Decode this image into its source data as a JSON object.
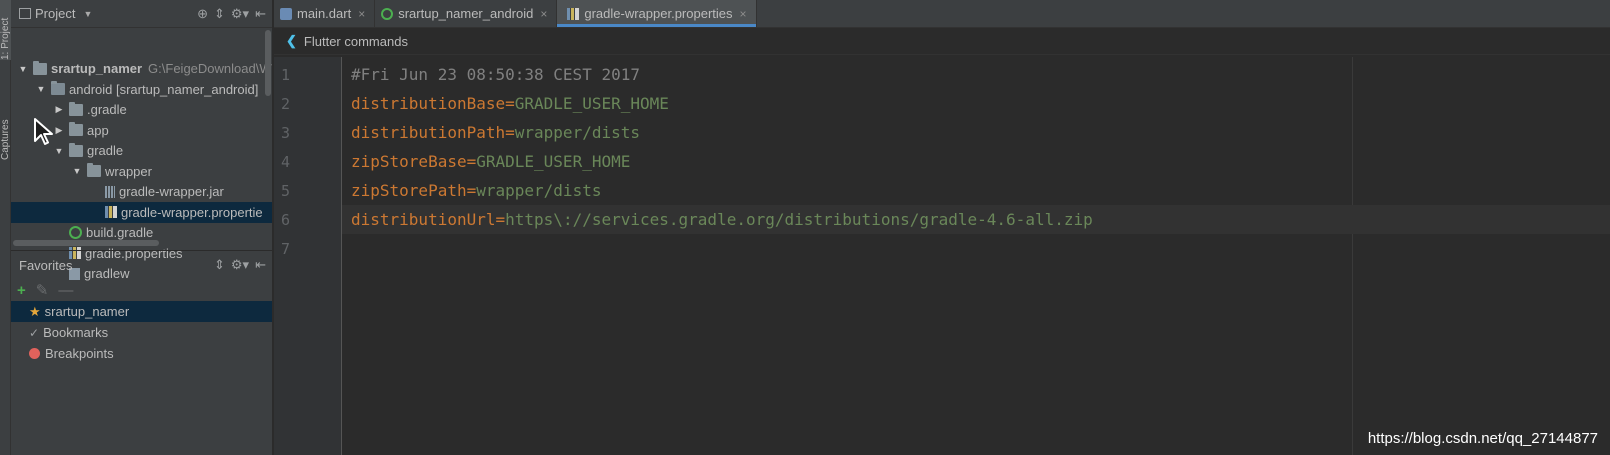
{
  "left_strip": {
    "project_tab": "1: Project",
    "captures_tab": "Captures"
  },
  "project_panel": {
    "title": "Project",
    "tree": [
      {
        "label": "srartup_namer",
        "extra": "G:\\FeigeDownload\\W",
        "depth": 0,
        "arrow": "▼",
        "icon": "folder",
        "bold": true
      },
      {
        "label": "android [srartup_namer_android]",
        "depth": 1,
        "arrow": "▼",
        "icon": "folder-mod",
        "bold": false
      },
      {
        "label": ".gradle",
        "depth": 2,
        "arrow": "▶",
        "icon": "folder"
      },
      {
        "label": "app",
        "depth": 2,
        "arrow": "▶",
        "icon": "folder"
      },
      {
        "label": "gradle",
        "depth": 2,
        "arrow": "▼",
        "icon": "folder"
      },
      {
        "label": "wrapper",
        "depth": 3,
        "arrow": "▼",
        "icon": "folder"
      },
      {
        "label": "gradle-wrapper.jar",
        "depth": 4,
        "arrow": "",
        "icon": "jar"
      },
      {
        "label": "gradle-wrapper.propertie",
        "depth": 4,
        "arrow": "",
        "icon": "props",
        "selected": true
      },
      {
        "label": "build.gradle",
        "depth": 2,
        "arrow": "",
        "icon": "gradle"
      },
      {
        "label": "gradle.properties",
        "depth": 2,
        "arrow": "",
        "icon": "props"
      },
      {
        "label": "gradlew",
        "depth": 2,
        "arrow": "",
        "icon": "script"
      }
    ]
  },
  "favorites": {
    "title": "Favorites",
    "items": [
      {
        "label": "srartup_namer",
        "icon": "star-icon",
        "selected": true
      },
      {
        "label": "Bookmarks",
        "icon": "check-icon"
      },
      {
        "label": "Breakpoints",
        "icon": "breakpoint-icon"
      }
    ]
  },
  "tabs": [
    {
      "label": "main.dart",
      "icon": "dart-icon",
      "active": false
    },
    {
      "label": "srartup_namer_android",
      "icon": "android-module-icon",
      "active": false
    },
    {
      "label": "gradle-wrapper.properties",
      "icon": "properties-icon",
      "active": true
    }
  ],
  "flutter_bar": {
    "label": "Flutter commands"
  },
  "code_lines": [
    {
      "num": "1",
      "key": "",
      "eq": "",
      "value": "",
      "comment": "#Fri Jun 23 08:50:38 CEST 2017"
    },
    {
      "num": "2",
      "key": "distributionBase",
      "eq": "=",
      "value": "GRADLE_USER_HOME",
      "comment": ""
    },
    {
      "num": "3",
      "key": "distributionPath",
      "eq": "=",
      "value": "wrapper/dists",
      "comment": ""
    },
    {
      "num": "4",
      "key": "zipStoreBase",
      "eq": "=",
      "value": "GRADLE_USER_HOME",
      "comment": ""
    },
    {
      "num": "5",
      "key": "zipStorePath",
      "eq": "=",
      "value": "wrapper/dists",
      "comment": ""
    },
    {
      "num": "6",
      "key": "distributionUrl",
      "eq": "=",
      "value": "https\\://services.gradle.org/distributions/gradle-4.6-all.zip",
      "comment": "",
      "current": true
    },
    {
      "num": "7",
      "key": "",
      "eq": "",
      "value": "",
      "comment": ""
    }
  ],
  "watermark": "https://blog.csdn.net/qq_27144877",
  "colors": {
    "accent": "#4a88c7",
    "keyword": "#cc7832",
    "string": "#6a8759",
    "comment": "#808080",
    "selection": "#0d293e"
  }
}
